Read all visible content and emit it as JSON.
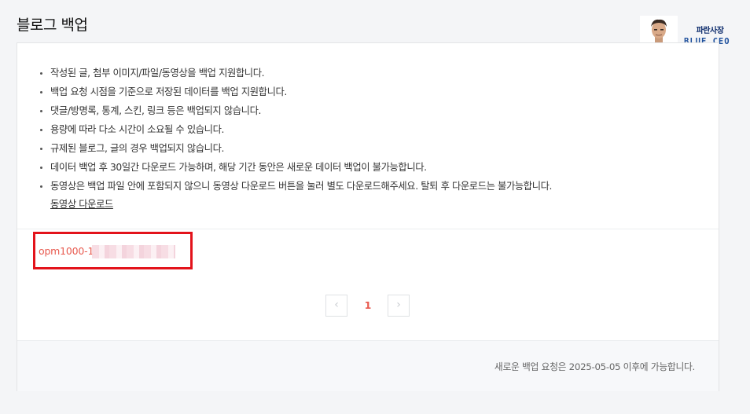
{
  "page": {
    "title": "블로그 백업"
  },
  "logo": {
    "text_ko": "파란사장",
    "text_en": "BLUE CEO",
    "colors": {
      "navy": "#0b2a6b",
      "blue": "#1d4f9c"
    }
  },
  "notice": {
    "items": [
      "작성된 글, 첨부 이미지/파일/동영상을 백업 지원합니다.",
      "백업 요청 시점을 기준으로 저장된 데이터를 백업 지원합니다.",
      "댓글/방명록, 통계, 스킨, 링크 등은 백업되지 않습니다.",
      "용량에 따라 다소 시간이 소요될 수 있습니다.",
      "규제된 블로그, 글의 경우 백업되지 않습니다.",
      "데이터 백업 후 30일간 다운로드 가능하며, 해당 기간 동안은 새로운 데이터 백업이 불가능합니다.",
      "동영상은 백업 파일 안에 포함되지 않으니 동영상 다운로드 버튼을 눌러 별도 다운로드해주세요. 탈퇴 후 다운로드는 불가능합니다."
    ],
    "video_download_link": "동영상 다운로드"
  },
  "backup_file": {
    "name": "opm1000-1",
    "highlight_color": "#e3131b",
    "text_color": "#e85a4f"
  },
  "pagination": {
    "prev_icon": "chevron-left-icon",
    "prev_glyph": "‹",
    "current_page": "1",
    "next_icon": "chevron-right-icon",
    "next_glyph": "›"
  },
  "footer": {
    "message": "새로운 백업 요청은 2025-05-05 이후에 가능합니다."
  }
}
